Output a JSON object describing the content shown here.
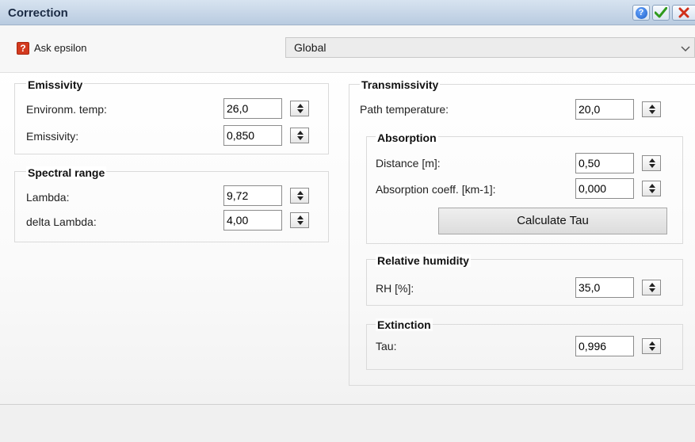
{
  "window": {
    "title": "Correction",
    "help_icon": "?",
    "ok_icon": "check-icon",
    "close_icon": "close-icon"
  },
  "ask": {
    "icon_glyph": "?",
    "label": "Ask epsilon",
    "mode_value": "Global"
  },
  "emissivity": {
    "title": "Emissivity",
    "env_temp_label": "Environm. temp:",
    "env_temp_value": "26,0",
    "emissivity_label": "Emissivity:",
    "emissivity_value": "0,850"
  },
  "spectral": {
    "title": "Spectral range",
    "lambda_label": "Lambda:",
    "lambda_value": "9,72",
    "delta_label": "delta Lambda:",
    "delta_value": "4,00"
  },
  "transmissivity": {
    "title": "Transmissivity",
    "path_temp_label": "Path temperature:",
    "path_temp_value": "20,0",
    "absorption": {
      "title": "Absorption",
      "distance_label": "Distance [m]:",
      "distance_value": "0,50",
      "coeff_label": "Absorption coeff. [km-1]:",
      "coeff_value": "0,000",
      "calc_button": "Calculate Tau"
    },
    "humidity": {
      "title": "Relative humidity",
      "rh_label": "RH [%]:",
      "rh_value": "35,0"
    },
    "extinction": {
      "title": "Extinction",
      "tau_label": "Tau:",
      "tau_value": "0,996"
    }
  },
  "colors": {
    "titlebar": "#c7d6e8",
    "help_blue": "#1d5fc8",
    "ok_green": "#2f9a1d",
    "close_red": "#d0301a",
    "ask_icon_red": "#d33a1f"
  }
}
